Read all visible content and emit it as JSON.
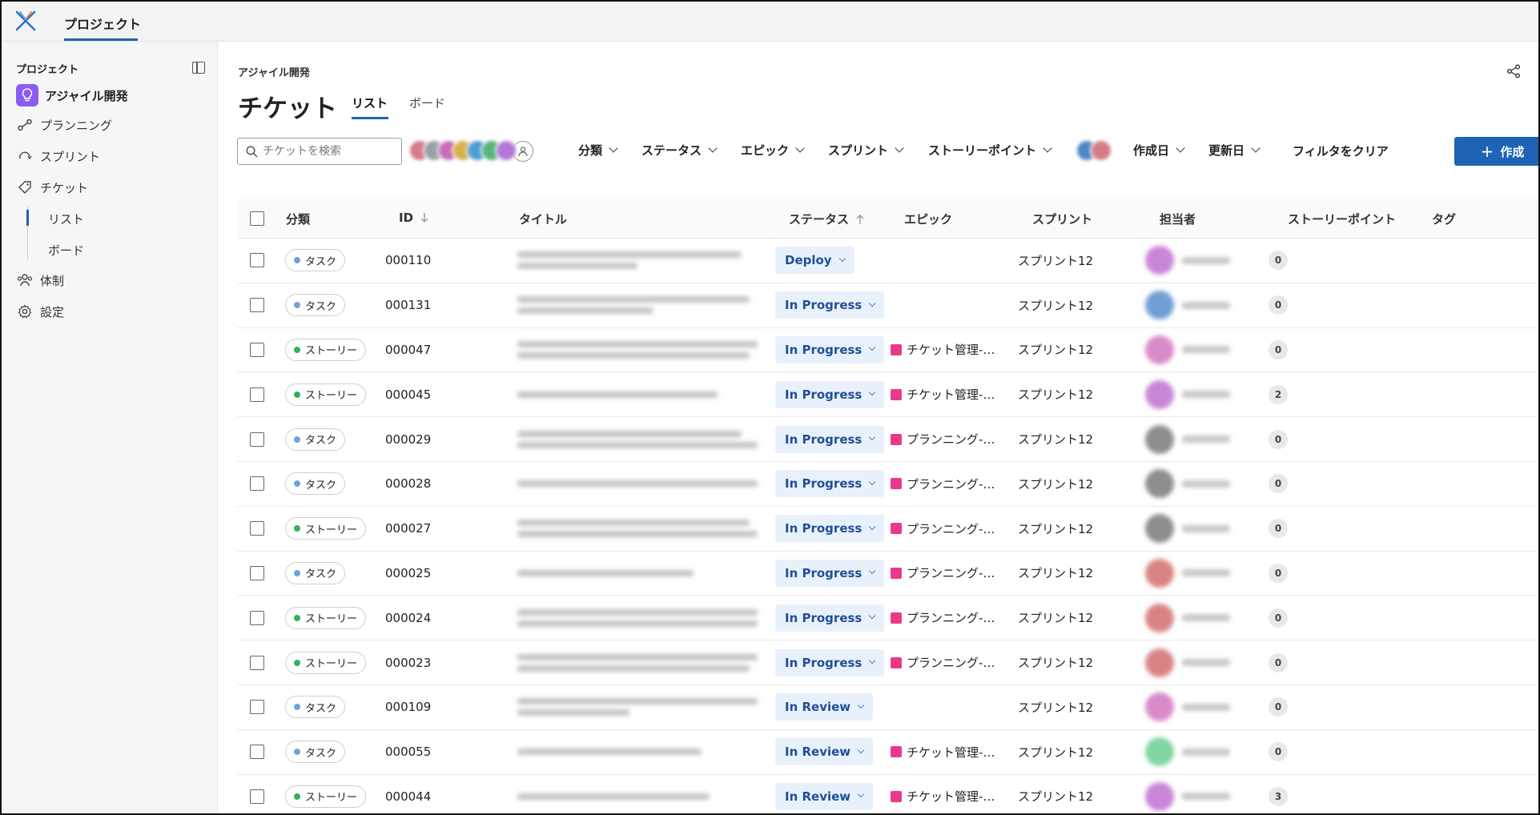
{
  "app": {
    "top_tab": "プロジェクト"
  },
  "sidebar": {
    "header": "プロジェクト",
    "project_name": "アジャイル開発",
    "items": [
      {
        "label": "プランニング",
        "icon": "planning-icon"
      },
      {
        "label": "スプリント",
        "icon": "sprint-icon"
      },
      {
        "label": "チケット",
        "icon": "ticket-icon"
      }
    ],
    "sub_items": [
      "リスト",
      "ボード"
    ],
    "items2": [
      {
        "label": "体制",
        "icon": "team-icon"
      },
      {
        "label": "設定",
        "icon": "gear-icon"
      }
    ]
  },
  "main": {
    "breadcrumb": "アジャイル開発",
    "title": "チケット",
    "tabs": [
      "リスト",
      "ボード"
    ],
    "search_placeholder": "チケットを検索",
    "filters": [
      "分類",
      "ステータス",
      "エピック",
      "スプリント",
      "ストーリーポイント",
      "作成日",
      "更新日"
    ],
    "clear_filter": "フィルタをクリア",
    "create_button": "作成"
  },
  "table": {
    "columns": [
      "分類",
      "ID",
      "タイトル",
      "ステータス",
      "エピック",
      "スプリント",
      "担当者",
      "ストーリーポイント",
      "タグ"
    ],
    "rows": [
      {
        "type": "タスク",
        "id": "000110",
        "status": "Deploy",
        "epic": "",
        "sprint": "スプリント12",
        "points": "0"
      },
      {
        "type": "タスク",
        "id": "000131",
        "status": "In Progress",
        "epic": "",
        "sprint": "スプリント12",
        "points": "0"
      },
      {
        "type": "ストーリー",
        "id": "000047",
        "status": "In Progress",
        "epic": "チケット管理-…",
        "sprint": "スプリント12",
        "points": "0"
      },
      {
        "type": "ストーリー",
        "id": "000045",
        "status": "In Progress",
        "epic": "チケット管理-…",
        "sprint": "スプリント12",
        "points": "2"
      },
      {
        "type": "タスク",
        "id": "000029",
        "status": "In Progress",
        "epic": "プランニング-…",
        "sprint": "スプリント12",
        "points": "0"
      },
      {
        "type": "タスク",
        "id": "000028",
        "status": "In Progress",
        "epic": "プランニング-…",
        "sprint": "スプリント12",
        "points": "0"
      },
      {
        "type": "ストーリー",
        "id": "000027",
        "status": "In Progress",
        "epic": "プランニング-…",
        "sprint": "スプリント12",
        "points": "0"
      },
      {
        "type": "タスク",
        "id": "000025",
        "status": "In Progress",
        "epic": "プランニング-…",
        "sprint": "スプリント12",
        "points": "0"
      },
      {
        "type": "ストーリー",
        "id": "000024",
        "status": "In Progress",
        "epic": "プランニング-…",
        "sprint": "スプリント12",
        "points": "0"
      },
      {
        "type": "ストーリー",
        "id": "000023",
        "status": "In Progress",
        "epic": "プランニング-…",
        "sprint": "スプリント12",
        "points": "0"
      },
      {
        "type": "タスク",
        "id": "000109",
        "status": "In Review",
        "epic": "",
        "sprint": "スプリント12",
        "points": "0"
      },
      {
        "type": "タスク",
        "id": "000055",
        "status": "In Review",
        "epic": "チケット管理-…",
        "sprint": "スプリント12",
        "points": "0"
      },
      {
        "type": "ストーリー",
        "id": "000044",
        "status": "In Review",
        "epic": "チケット管理-…",
        "sprint": "スプリント12",
        "points": "3"
      }
    ]
  },
  "colors": {
    "accent": "#1f63b4",
    "task_dot": "#6fa3e0",
    "story_dot": "#2fb35a",
    "epic": "#e93a8a",
    "project_icon": "#8a5cf6"
  }
}
